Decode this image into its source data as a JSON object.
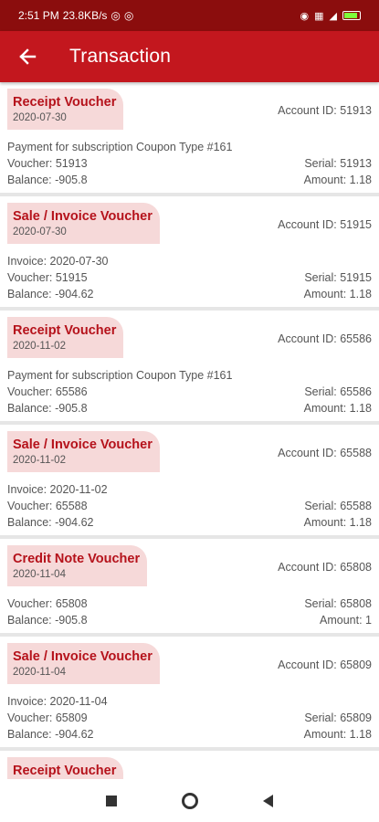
{
  "status": {
    "time": "2:51 PM",
    "speed": "23.8KB/s",
    "battery_level": 0.9
  },
  "header": {
    "title": "Transaction"
  },
  "transactions": [
    {
      "type": "Receipt Voucher",
      "date": "2020-07-30",
      "account": "Account ID: 51913",
      "note": "Payment for subscription Coupon Type #161",
      "voucher": "Voucher: 51913",
      "balance": "Balance: -905.8",
      "serial": "Serial: 51913",
      "amount": "Amount: 1.18"
    },
    {
      "type": "Sale / Invoice Voucher",
      "date": "2020-07-30",
      "account": "Account ID: 51915",
      "note": "Invoice: 2020-07-30",
      "voucher": "Voucher: 51915",
      "balance": "Balance: -904.62",
      "serial": "Serial: 51915",
      "amount": "Amount: 1.18"
    },
    {
      "type": "Receipt Voucher",
      "date": "2020-11-02",
      "account": "Account ID: 65586",
      "note": "Payment for subscription Coupon Type #161",
      "voucher": "Voucher: 65586",
      "balance": "Balance: -905.8",
      "serial": "Serial: 65586",
      "amount": "Amount: 1.18"
    },
    {
      "type": "Sale / Invoice Voucher",
      "date": "2020-11-02",
      "account": "Account ID: 65588",
      "note": "Invoice: 2020-11-02",
      "voucher": "Voucher: 65588",
      "balance": "Balance: -904.62",
      "serial": "Serial: 65588",
      "amount": "Amount: 1.18"
    },
    {
      "type": "Credit Note Voucher",
      "date": "2020-11-04",
      "account": "Account ID: 65808",
      "voucher": "Voucher: 65808",
      "balance": "Balance: -905.8",
      "serial": "Serial: 65808",
      "amount": "Amount: 1"
    },
    {
      "type": "Sale / Invoice Voucher",
      "date": "2020-11-04",
      "account": "Account ID: 65809",
      "note": "Invoice: 2020-11-04",
      "voucher": "Voucher: 65809",
      "balance": "Balance: -904.62",
      "serial": "Serial: 65809",
      "amount": "Amount: 1.18"
    },
    {
      "type": "Receipt Voucher"
    }
  ],
  "nav": {
    "items": [
      "recents-button",
      "home-button",
      "back-button"
    ]
  },
  "colors": {
    "app_bar": "#c3171e",
    "status_bar": "#8b0d0d",
    "pill_bg": "#f6d9d9",
    "accent_text": "#b5121b"
  }
}
